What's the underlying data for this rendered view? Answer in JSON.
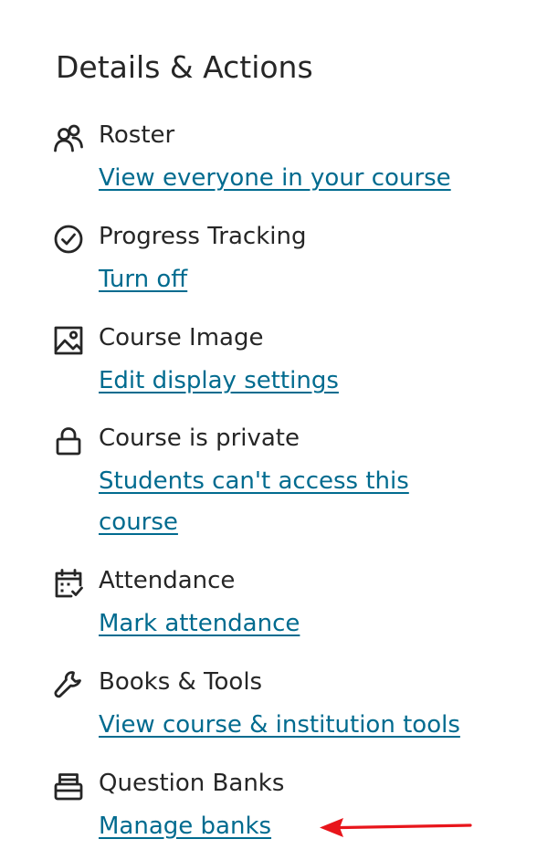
{
  "panel": {
    "title": "Details & Actions"
  },
  "items": [
    {
      "title": "Roster",
      "link": "View everyone in your course",
      "icon": "roster-icon"
    },
    {
      "title": "Progress Tracking",
      "link": "Turn off",
      "icon": "check-circle-icon"
    },
    {
      "title": "Course Image",
      "link": "Edit display settings",
      "icon": "image-icon"
    },
    {
      "title": "Course is private",
      "link": "Students can't access this course",
      "icon": "lock-icon"
    },
    {
      "title": "Attendance",
      "link": "Mark attendance",
      "icon": "calendar-check-icon"
    },
    {
      "title": "Books & Tools",
      "link": "View course & institution tools",
      "icon": "wrench-icon"
    },
    {
      "title": "Question Banks",
      "link": "Manage banks",
      "icon": "question-bank-icon"
    }
  ],
  "colors": {
    "text": "#262626",
    "link": "#006b8f",
    "annotation_arrow": "#e8151b"
  }
}
